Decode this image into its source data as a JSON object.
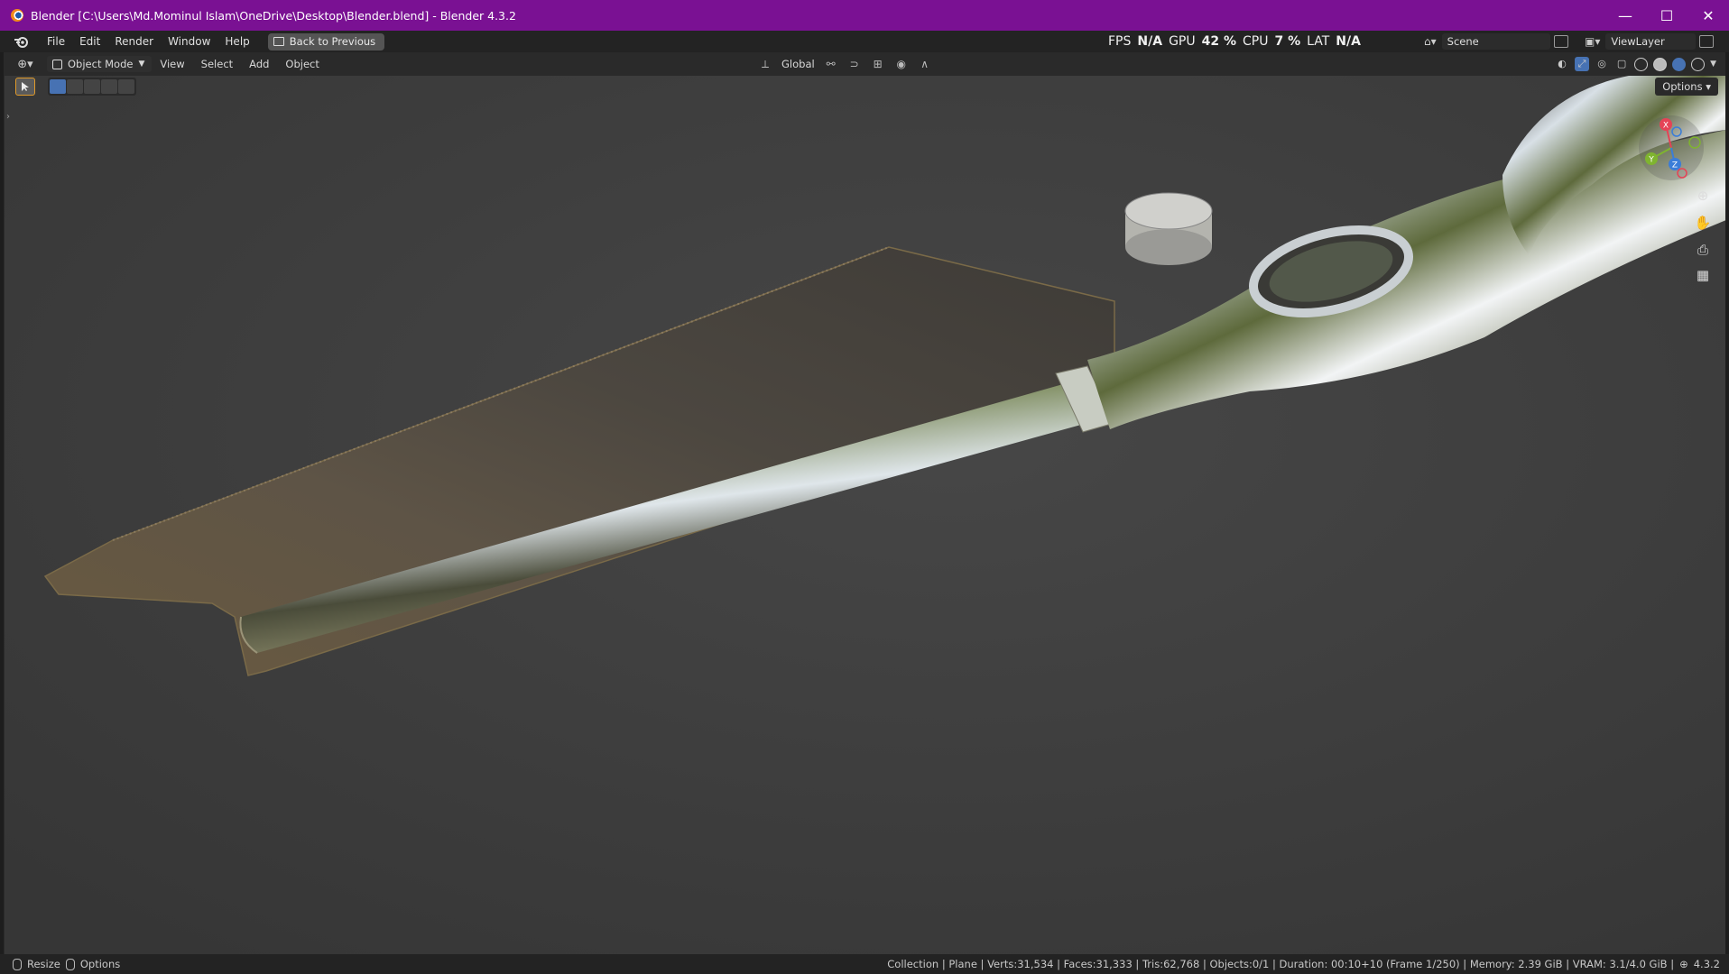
{
  "window": {
    "title": "Blender [C:\\Users\\Md.Mominul Islam\\OneDrive\\Desktop\\Blender.blend] - Blender 4.3.2",
    "minimize_glyph": "—",
    "maximize_glyph": "☐",
    "close_glyph": "✕"
  },
  "menubar": {
    "items": [
      "File",
      "Edit",
      "Render",
      "Window",
      "Help"
    ],
    "back_button": "Back to Previous",
    "stats": {
      "fps_label": "FPS",
      "fps_value": "N/A",
      "gpu_label": "GPU",
      "gpu_value": "42 %",
      "cpu_label": "CPU",
      "cpu_value": "7 %",
      "lat_label": "LAT",
      "lat_value": "N/A"
    },
    "scene": "Scene",
    "view_layer": "ViewLayer"
  },
  "viewport_header": {
    "mode": "Object Mode",
    "menus": [
      "View",
      "Select",
      "Add",
      "Object"
    ],
    "transform_orientation": "Global"
  },
  "viewport": {
    "options_label": "Options",
    "gizmo_axes": {
      "x": "X",
      "y": "Y",
      "z": "Z"
    }
  },
  "statusbar": {
    "left_action": "Resize",
    "left_options": "Options",
    "info": "Collection | Plane | Verts:31,534 | Faces:31,333 | Tris:62,768 | Objects:0/1 | Duration: 00:10+10 (Frame 1/250) | Memory: 2.39 GiB | VRAM: 3.1/4.0 GiB |",
    "version": "4.3.2"
  },
  "colors": {
    "titlebar": "#7a1193",
    "accent": "#4772b3",
    "viewport_bg": "#3d3d3d"
  }
}
